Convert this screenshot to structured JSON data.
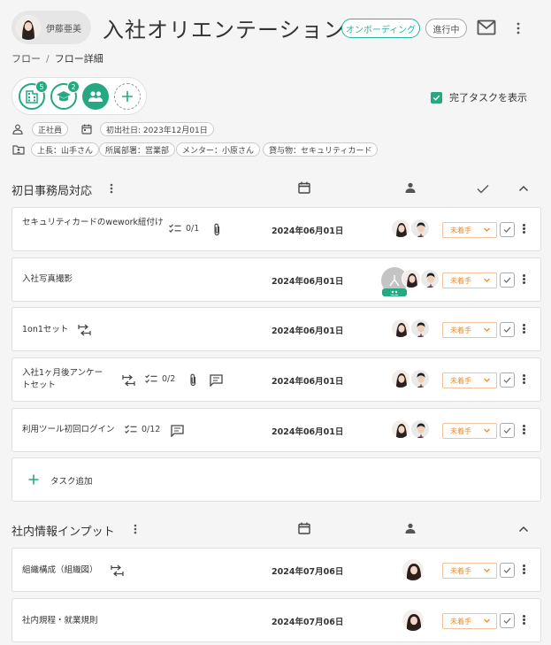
{
  "header": {
    "user_name": "伊藤亜美",
    "title": "入社オリエンテーション",
    "status_pill": "オンボーディング",
    "progress_pill": "進行中",
    "icons": [
      "mail-icon",
      "more-vert-icon"
    ]
  },
  "breadcrumb": {
    "root": "フロー",
    "separator": "/",
    "current": "フロー詳細"
  },
  "categories": [
    {
      "icon": "building-icon",
      "badge": "5"
    },
    {
      "icon": "graduation-cap-icon",
      "badge": "2"
    },
    {
      "icon": "people-icon",
      "badge": ""
    },
    {
      "icon": "add-icon",
      "badge": ""
    }
  ],
  "show_done": {
    "label": "完了タスクを表示",
    "checked": true
  },
  "info": {
    "employment_type": "正社員",
    "start_date": "初出社日: 2023年12月01日",
    "tags": [
      "上長：山手さん",
      "所属部署：営業部",
      "メンター：小原さん",
      "貸与物：セキュリティカード"
    ]
  },
  "sections": [
    {
      "title": "初日事務局対応",
      "tasks": [
        {
          "name": "セキュリティカードのwework紐付け",
          "checklist": "0/1",
          "attachment": true,
          "comment": false,
          "linked": false,
          "date": "2024年06月01日",
          "status": "未着手",
          "assignees": [
            "woman",
            "man"
          ]
        },
        {
          "name": "入社写真撮影",
          "checklist": "",
          "attachment": false,
          "comment": false,
          "linked": false,
          "date": "2024年06月01日",
          "status": "未着手",
          "assignees": [
            "group",
            "woman",
            "man"
          ]
        },
        {
          "name": "1on1セット",
          "checklist": "",
          "attachment": false,
          "comment": false,
          "linked": true,
          "date": "2024年06月01日",
          "status": "未着手",
          "assignees": [
            "woman",
            "man"
          ]
        },
        {
          "name": "入社1ヶ月後アンケートセット",
          "checklist": "0/2",
          "attachment": true,
          "comment": true,
          "linked": true,
          "date": "2024年06月01日",
          "status": "未着手",
          "assignees": [
            "woman",
            "man"
          ]
        },
        {
          "name": "利用ツール初回ログイン",
          "checklist": "0/12",
          "attachment": false,
          "comment": true,
          "linked": false,
          "date": "2024年06月01日",
          "status": "未着手",
          "assignees": [
            "woman",
            "man"
          ]
        }
      ],
      "add_task_label": "タスク追加"
    },
    {
      "title": "社内情報インプット",
      "tasks": [
        {
          "name": "組織構成（組織図）",
          "checklist": "",
          "attachment": false,
          "comment": false,
          "linked": true,
          "date": "2024年07月06日",
          "status": "未着手",
          "assignees": [
            "woman2"
          ]
        },
        {
          "name": "社内規程・就業規則",
          "checklist": "",
          "attachment": false,
          "comment": false,
          "linked": false,
          "date": "2024年07月06日",
          "status": "未着手",
          "assignees": [
            "woman2"
          ]
        }
      ]
    }
  ],
  "colors": {
    "accent": "#26a883",
    "status_pill": "#26b3a4",
    "task_status": "#f08c28",
    "background": "#f5f5f5"
  }
}
